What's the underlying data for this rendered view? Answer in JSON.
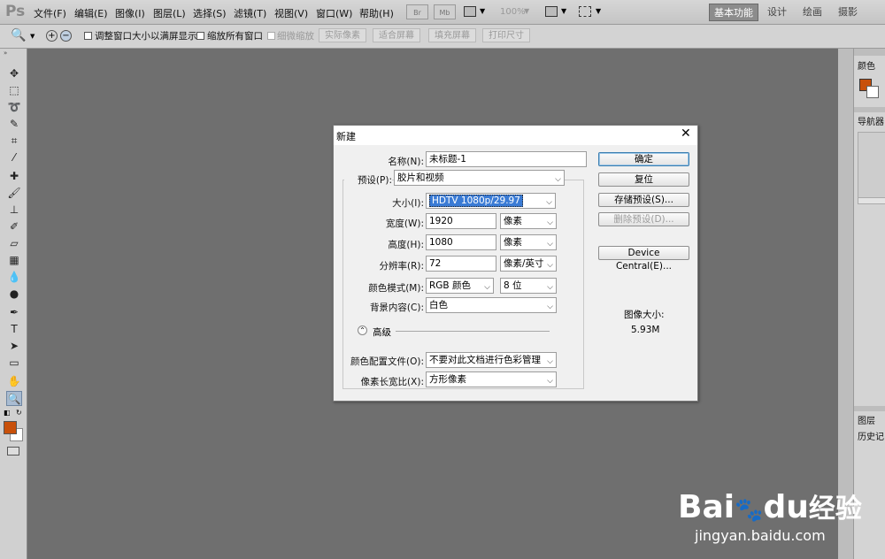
{
  "app": {
    "logo": "Ps"
  },
  "menu": [
    "文件(F)",
    "编辑(E)",
    "图像(I)",
    "图层(L)",
    "选择(S)",
    "滤镜(T)",
    "视图(V)",
    "窗口(W)",
    "帮助(H)"
  ],
  "topbar": {
    "br_label": "Br",
    "mb_label": "Mb",
    "zoom": "100%"
  },
  "workspaces": {
    "basic": "基本功能",
    "design": "设计",
    "painting": "绘画",
    "photography": "摄影"
  },
  "options": {
    "resize_windows": "调整窗口大小以满屏显示",
    "zoom_all_windows": "缩放所有窗口",
    "scrubby_zoom": "细微缩放",
    "actual_pixels": "实际像素",
    "fit_screen": "适合屏幕",
    "fill_screen": "填充屏幕",
    "print_size": "打印尺寸"
  },
  "panels": {
    "color": "颜色",
    "navigator": "导航器",
    "layers": "图层",
    "history": "历史记"
  },
  "colors": {
    "foreground": "#c8500a",
    "background": "#ffffff",
    "selection": "#3a7bd5"
  },
  "dialog": {
    "title": "新建",
    "name_label": "名称(N):",
    "name_value": "未标题-1",
    "preset_label": "预设(P):",
    "preset_value": "胶片和视频",
    "size_label": "大小(I):",
    "size_value": "HDTV 1080p/29.97",
    "width_label": "宽度(W):",
    "width_value": "1920",
    "width_unit": "像素",
    "height_label": "高度(H):",
    "height_value": "1080",
    "height_unit": "像素",
    "resolution_label": "分辨率(R):",
    "resolution_value": "72",
    "resolution_unit": "像素/英寸",
    "color_mode_label": "颜色模式(M):",
    "color_mode_value": "RGB 颜色",
    "bit_depth": "8 位",
    "background_label": "背景内容(C):",
    "background_value": "白色",
    "advanced_label": "高级",
    "color_profile_label": "颜色配置文件(O):",
    "color_profile_value": "不要对此文档进行色彩管理",
    "pixel_aspect_label": "像素长宽比(X):",
    "pixel_aspect_value": "方形像素",
    "ok_button": "确定",
    "reset_button": "复位",
    "save_preset_button": "存储预设(S)...",
    "delete_preset_button": "删除预设(D)...",
    "device_central_button": "Device Central(E)...",
    "image_size_label": "图像大小:",
    "image_size_value": "5.93M"
  },
  "watermark": {
    "brand": "Bai",
    "brand2": "du",
    "brand_cn": "经验",
    "url": "jingyan.baidu.com"
  }
}
